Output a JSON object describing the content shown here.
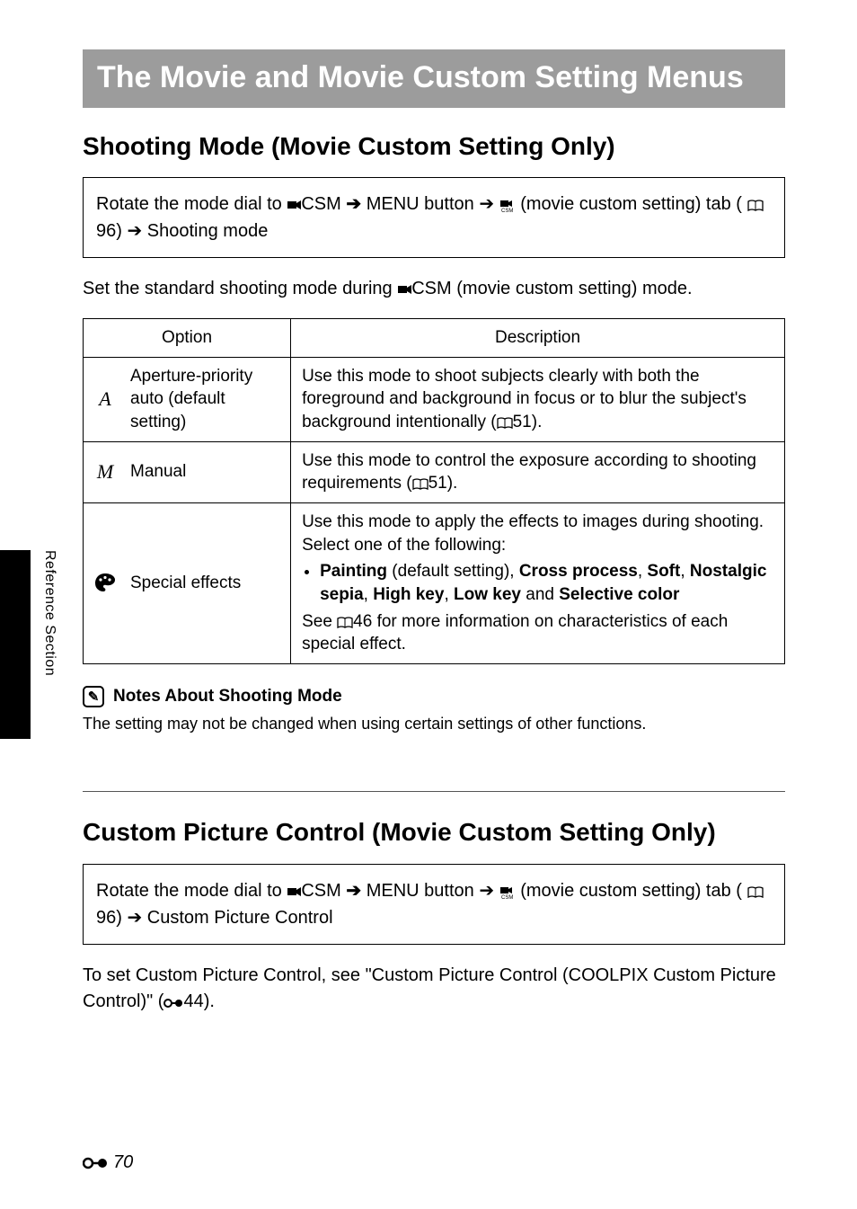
{
  "side_tab_label": "Reference Section",
  "title": "The Movie and Movie Custom Setting Menus",
  "section1": {
    "heading": "Shooting Mode (Movie Custom Setting Only)",
    "path_pre": "Rotate the mode dial to ",
    "path_csm": "CSM",
    "path_arrow1": " ➔ ",
    "path_menu": "MENU",
    "path_btn": " button ➔ ",
    "path_tabtext": " (movie custom setting) tab (",
    "path_pageref": "96) ➔ Shooting mode",
    "intro_a": "Set the standard shooting mode during ",
    "intro_b": "CSM",
    "intro_c": " (movie custom setting) mode.",
    "table": {
      "h_option": "Option",
      "h_desc": "Description",
      "rows": [
        {
          "sym": "A",
          "name": "Aperture-priority auto (default setting)",
          "desc_a": "Use this mode to shoot subjects clearly with both the foreground and background in focus or to blur the subject's background intentionally (",
          "desc_ref": "51).",
          "type": "simple"
        },
        {
          "sym": "M",
          "name": "Manual",
          "desc_a": "Use this mode to control the exposure according to shooting requirements (",
          "desc_ref": "51).",
          "type": "simple"
        },
        {
          "sym": "effect",
          "name": "Special effects",
          "desc_a": "Use this mode to apply the effects to images during shooting. Select one of the following:",
          "bullets_strong1": "Painting",
          "bullets_plain1": " (default setting), ",
          "bullets_strong2": "Cross process",
          "bullets_plain2": ", ",
          "bullets_strong3": "Soft",
          "bullets_plain3": ", ",
          "bullets_strong4": "Nostalgic sepia",
          "bullets_plain4": ", ",
          "bullets_strong5": "High key",
          "bullets_plain5": ", ",
          "bullets_strong6": "Low key",
          "bullets_plain6": " and ",
          "bullets_strong7": "Selective color",
          "desc_see_a": "See ",
          "desc_see_ref": "46 for more information on characteristics of each special effect.",
          "type": "effects"
        }
      ]
    },
    "notes_head": "Notes About Shooting Mode",
    "notes_body": "The setting may not be changed when using certain settings of other functions."
  },
  "section2": {
    "heading": "Custom Picture Control (Movie Custom Setting Only)",
    "path_pre": "Rotate the mode dial to ",
    "path_csm": "CSM",
    "path_arrow1": " ➔ ",
    "path_menu": "MENU",
    "path_btn": " button ➔ ",
    "path_tabtext": " (movie custom setting) tab (",
    "path_pageref": "96) ➔ Custom Picture Control",
    "body_a": "To set Custom Picture Control, see \"Custom Picture Control (COOLPIX Custom Picture Control)\" (",
    "body_ref": "44)."
  },
  "footer_page": "70"
}
